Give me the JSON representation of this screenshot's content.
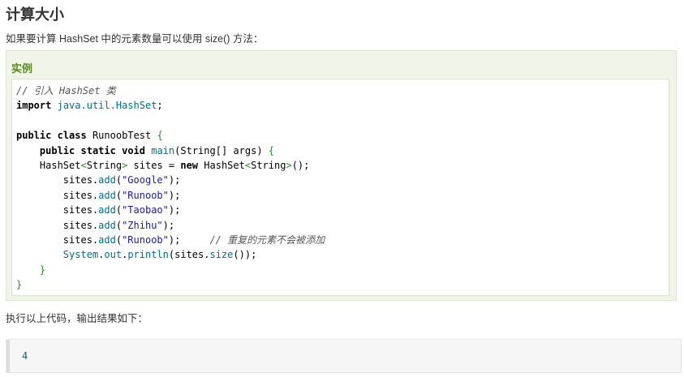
{
  "section": {
    "title": "计算大小",
    "intro": "如果要计算 HashSet 中的元素数量可以使用 size() 方法："
  },
  "example": {
    "title": "实例",
    "code": {
      "comment1": "// 引入 HashSet 类",
      "import_kw": "import",
      "import_path": "java.util.HashSet",
      "public_kw": "public",
      "class_kw": "class",
      "class_name": "RunoobTest",
      "static_kw": "static",
      "void_kw": "void",
      "main_name": "main",
      "string_type": "String",
      "args": "args",
      "hashset_type": "HashSet",
      "sites": "sites",
      "new_kw": "new",
      "add": "add",
      "strings": [
        "\"Google\"",
        "\"Runoob\"",
        "\"Taobao\"",
        "\"Zhihu\"",
        "\"Runoob\""
      ],
      "comment2": "// 重复的元素不会被添加",
      "system": "System",
      "out": "out",
      "println": "println",
      "size": "size"
    }
  },
  "after_text": "执行以上代码，输出结果如下：",
  "output": {
    "value": "4"
  }
}
